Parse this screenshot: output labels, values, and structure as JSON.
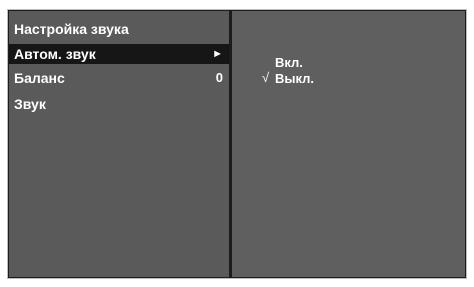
{
  "menu": {
    "title": "Настройка звука",
    "items": [
      {
        "label": "Автом. звук",
        "indicator": "►",
        "selected": true
      },
      {
        "label": "Баланс",
        "value": "0",
        "selected": false
      },
      {
        "label": "Звук",
        "selected": false
      }
    ]
  },
  "submenu": {
    "options": [
      {
        "label": "Вкл.",
        "checked": false
      },
      {
        "label": "Выкл.",
        "checked": true
      }
    ],
    "check_mark": "√"
  },
  "colors": {
    "frame": "#1c1c1c",
    "left_panel": "#5a5a5a",
    "right_panel": "#5f5f5f",
    "selected_row": "#161616",
    "text": "#ffffff"
  }
}
